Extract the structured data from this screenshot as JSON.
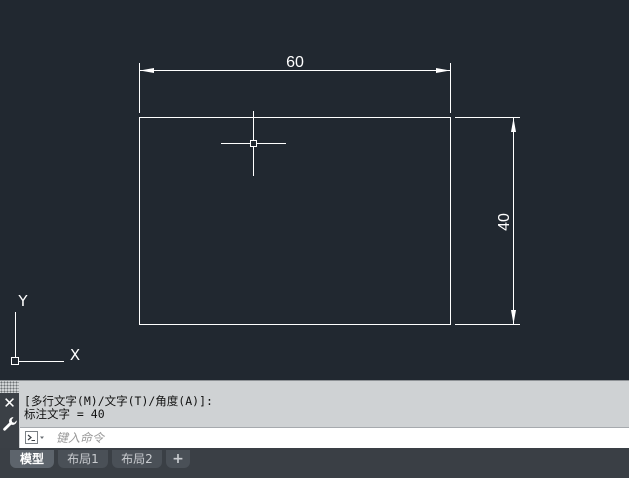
{
  "drawing": {
    "horizontal_dimension": "60",
    "vertical_dimension": "40",
    "ucs_y_label": "Y",
    "ucs_x_label": "X"
  },
  "command_line": {
    "history": [
      "[多行文字(M)/文字(T)/角度(A)]:",
      "标注文字 = 40"
    ],
    "input_value": "",
    "input_placeholder": "键入命令",
    "close_label": "✕"
  },
  "layout_tabs": {
    "tabs": [
      {
        "label": "模型",
        "active": true
      },
      {
        "label": "布局1",
        "active": false
      },
      {
        "label": "布局2",
        "active": false
      }
    ],
    "add_label": "+"
  },
  "colors": {
    "canvas_background": "#212830",
    "line_color": "#ffffff"
  }
}
